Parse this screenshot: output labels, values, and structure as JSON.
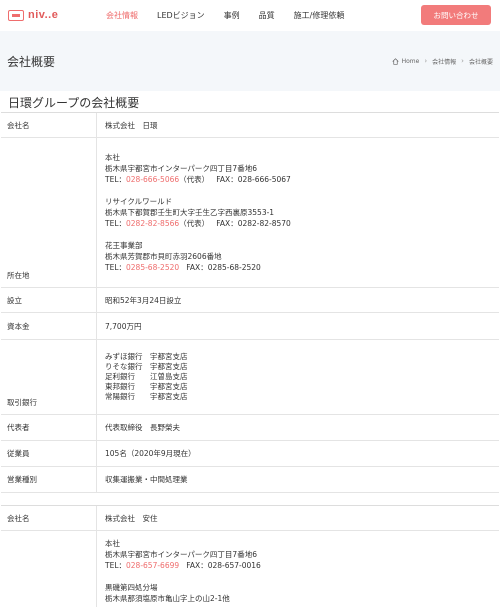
{
  "header": {
    "logo_text": "niv..e",
    "nav": [
      "会社情報",
      "LEDビジョン",
      "事例",
      "品質",
      "施工/修理依頼"
    ],
    "contact_label": "お問い合わせ"
  },
  "page_head": {
    "title": "会社概要",
    "breadcrumb": [
      "Home",
      "会社情報",
      "会社概要"
    ]
  },
  "section_title": "日環グループの会社概要",
  "company1": {
    "name_label": "会社名",
    "name_value": "株式会社　日環",
    "address_label": "所在地",
    "offices": [
      {
        "name": "本社",
        "address": "栃木県宇都宮市インターパーク四丁目7番地6",
        "tel_label": "TEL：",
        "tel": "028-666-5066",
        "tel_note": "（代表）",
        "fax": "FAX：028-666-5067"
      },
      {
        "name": "リサイクルワールド",
        "address": "栃木県下都賀郡壬生町大字壬生乙字西裏原3553-1",
        "tel_label": "TEL：",
        "tel": "0282-82-8566",
        "tel_note": "（代表）",
        "fax": "FAX：0282-82-8570"
      },
      {
        "name": "花王事業部",
        "address": "栃木県芳賀郡市貝町赤羽2606番地",
        "tel_label": "TEL：",
        "tel": "0285-68-2520",
        "tel_note": "",
        "fax": "FAX：0285-68-2520"
      }
    ],
    "founded_label": "設立",
    "founded_value": "昭和52年3月24日設立",
    "capital_label": "資本金",
    "capital_value": "7,700万円",
    "banks_label": "取引銀行",
    "banks": [
      {
        "bank": "みずほ銀行",
        "branch": "宇都宮支店"
      },
      {
        "bank": "りそな銀行",
        "branch": "宇都宮支店"
      },
      {
        "bank": "足利銀行",
        "branch": "江曽島支店"
      },
      {
        "bank": "東邦銀行",
        "branch": "宇都宮支店"
      },
      {
        "bank": "常陽銀行",
        "branch": "宇都宮支店"
      }
    ],
    "rep_label": "代表者",
    "rep_value": "代表取締役　長野榮夫",
    "employees_label": "従業員",
    "employees_value": "105名（2020年9月現在）",
    "business_label": "営業種別",
    "business_value": "収集運搬業・中間処理業"
  },
  "company2": {
    "name_label": "会社名",
    "name_value": "株式会社　安住",
    "offices": [
      {
        "name": "本社",
        "address": "栃木県宇都宮市インターパーク四丁目7番地6",
        "tel_label": "TEL：",
        "tel": "028-657-6699",
        "fax": "FAX：028-657-0016"
      },
      {
        "name": "黒磯第四処分場",
        "address": "栃木県那須塩原市亀山字上の山2-1他"
      }
    ]
  }
}
